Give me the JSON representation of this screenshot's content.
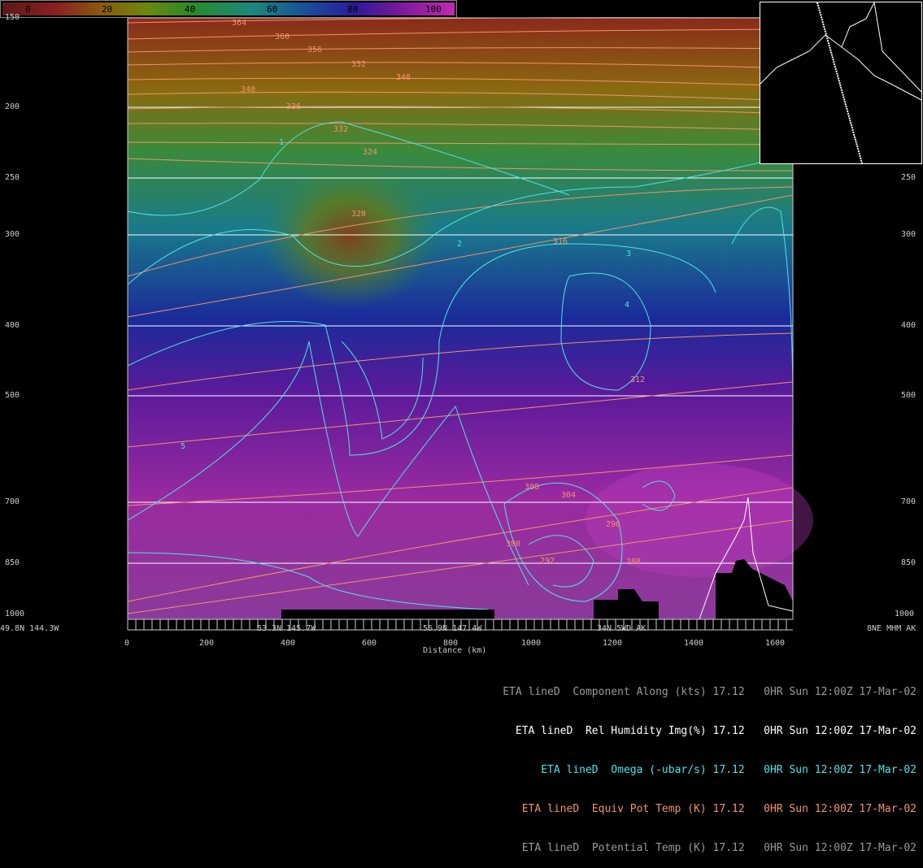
{
  "colorbar": {
    "ticks": [
      "0",
      "20",
      "40",
      "60",
      "80",
      "100"
    ]
  },
  "y_axis": {
    "levels": [
      "150",
      "200",
      "250",
      "300",
      "400",
      "500",
      "700",
      "850",
      "1000"
    ]
  },
  "x_axis": {
    "title": "Distance (km)",
    "ticks": [
      "0",
      "200",
      "400",
      "600",
      "800",
      "1000",
      "1200",
      "1400",
      "1600"
    ],
    "waypoints": [
      "49.8N 144.3W",
      "53.3N 145.7W",
      "56.9N 147.4W",
      "34N 5WD AK",
      "8NE MHM AK"
    ]
  },
  "legend": {
    "rows": [
      {
        "model": "ETA lineD",
        "field": "Component Along (kts)",
        "value": "17.12",
        "time": "0HR Sun 12:00Z 17-Mar-02",
        "color": "#9a9a9a"
      },
      {
        "model": "ETA lineD",
        "field": "Rel Humidity Img(%)",
        "value": "17.12",
        "time": "0HR Sun 12:00Z 17-Mar-02",
        "color": "#ffffff"
      },
      {
        "model": "ETA lineD",
        "field": "Omega (-ubar/s)",
        "value": "17.12",
        "time": "0HR Sun 12:00Z 17-Mar-02",
        "color": "#4fe3e3"
      },
      {
        "model": "ETA lineD",
        "field": "Equiv Pot Temp (K)",
        "value": "17.12",
        "time": "0HR Sun 12:00Z 17-Mar-02",
        "color": "#f0936a"
      },
      {
        "model": "ETA lineD",
        "field": "Potential Temp (K)",
        "value": "17.12",
        "time": "0HR Sun 12:00Z 17-Mar-02",
        "color": "#9a9a9a"
      }
    ]
  },
  "contour_labels": {
    "theta": [
      "368",
      "364",
      "360",
      "356",
      "352",
      "348",
      "344",
      "340",
      "336",
      "332",
      "328",
      "324",
      "320",
      "316",
      "312",
      "308",
      "304",
      "300",
      "296",
      "292",
      "288"
    ],
    "omega": [
      "1",
      "2",
      "3",
      "4",
      "5"
    ]
  },
  "colors": {
    "omega": "#4fe3e3",
    "theta_e": "#f0936a",
    "grid": "#ffffff"
  }
}
